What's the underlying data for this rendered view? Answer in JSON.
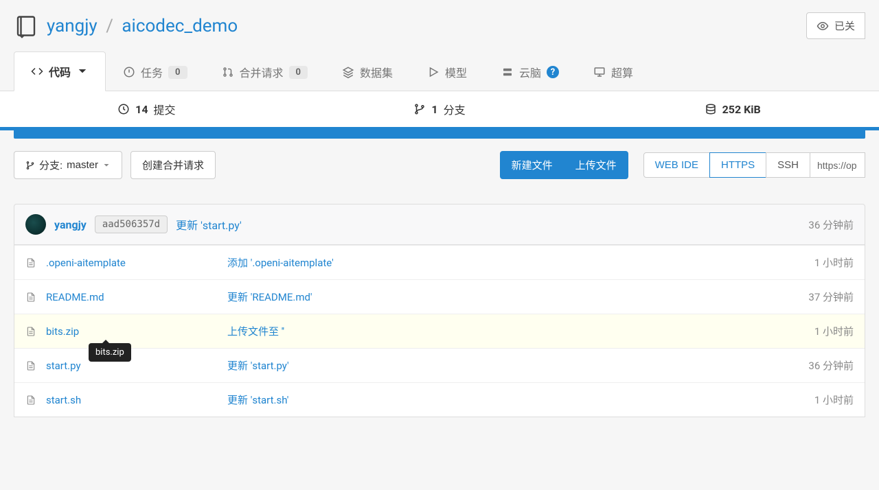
{
  "breadcrumb": {
    "owner": "yangjy",
    "sep": "/",
    "repo": "aicodec_demo"
  },
  "watch": {
    "label": "已关"
  },
  "tabs": {
    "code": "代码",
    "issues": "任务",
    "issues_count": "0",
    "pulls": "合并请求",
    "pulls_count": "0",
    "datasets": "数据集",
    "models": "模型",
    "cloudbrain": "云脑",
    "supercompute": "超算"
  },
  "stats": {
    "commits_n": "14",
    "commits_label": "提交",
    "branches_n": "1",
    "branches_label": "分支",
    "size": "252 KiB"
  },
  "actions": {
    "branch_prefix": "分支:",
    "branch_name": "master",
    "create_pr": "创建合并请求",
    "new_file": "新建文件",
    "upload_file": "上传文件",
    "web_ide": "WEB IDE",
    "https": "HTTPS",
    "ssh": "SSH",
    "clone_url": "https://op"
  },
  "latest_commit": {
    "author": "yangjy",
    "sha": "aad506357d",
    "message": "更新 'start.py'",
    "time": "36 分钟前"
  },
  "tooltip": "bits.zip",
  "files": [
    {
      "name": ".openi-aitemplate",
      "msg": "添加 '.openi-aitemplate'",
      "time": "1 小时前",
      "hl": false
    },
    {
      "name": "README.md",
      "msg": "更新 'README.md'",
      "time": "37 分钟前",
      "hl": false
    },
    {
      "name": "bits.zip",
      "msg": "上传文件至 ''",
      "time": "1 小时前",
      "hl": true
    },
    {
      "name": "start.py",
      "msg": "更新 'start.py'",
      "time": "36 分钟前",
      "hl": false
    },
    {
      "name": "start.sh",
      "msg": "更新 'start.sh'",
      "time": "1 小时前",
      "hl": false
    }
  ]
}
